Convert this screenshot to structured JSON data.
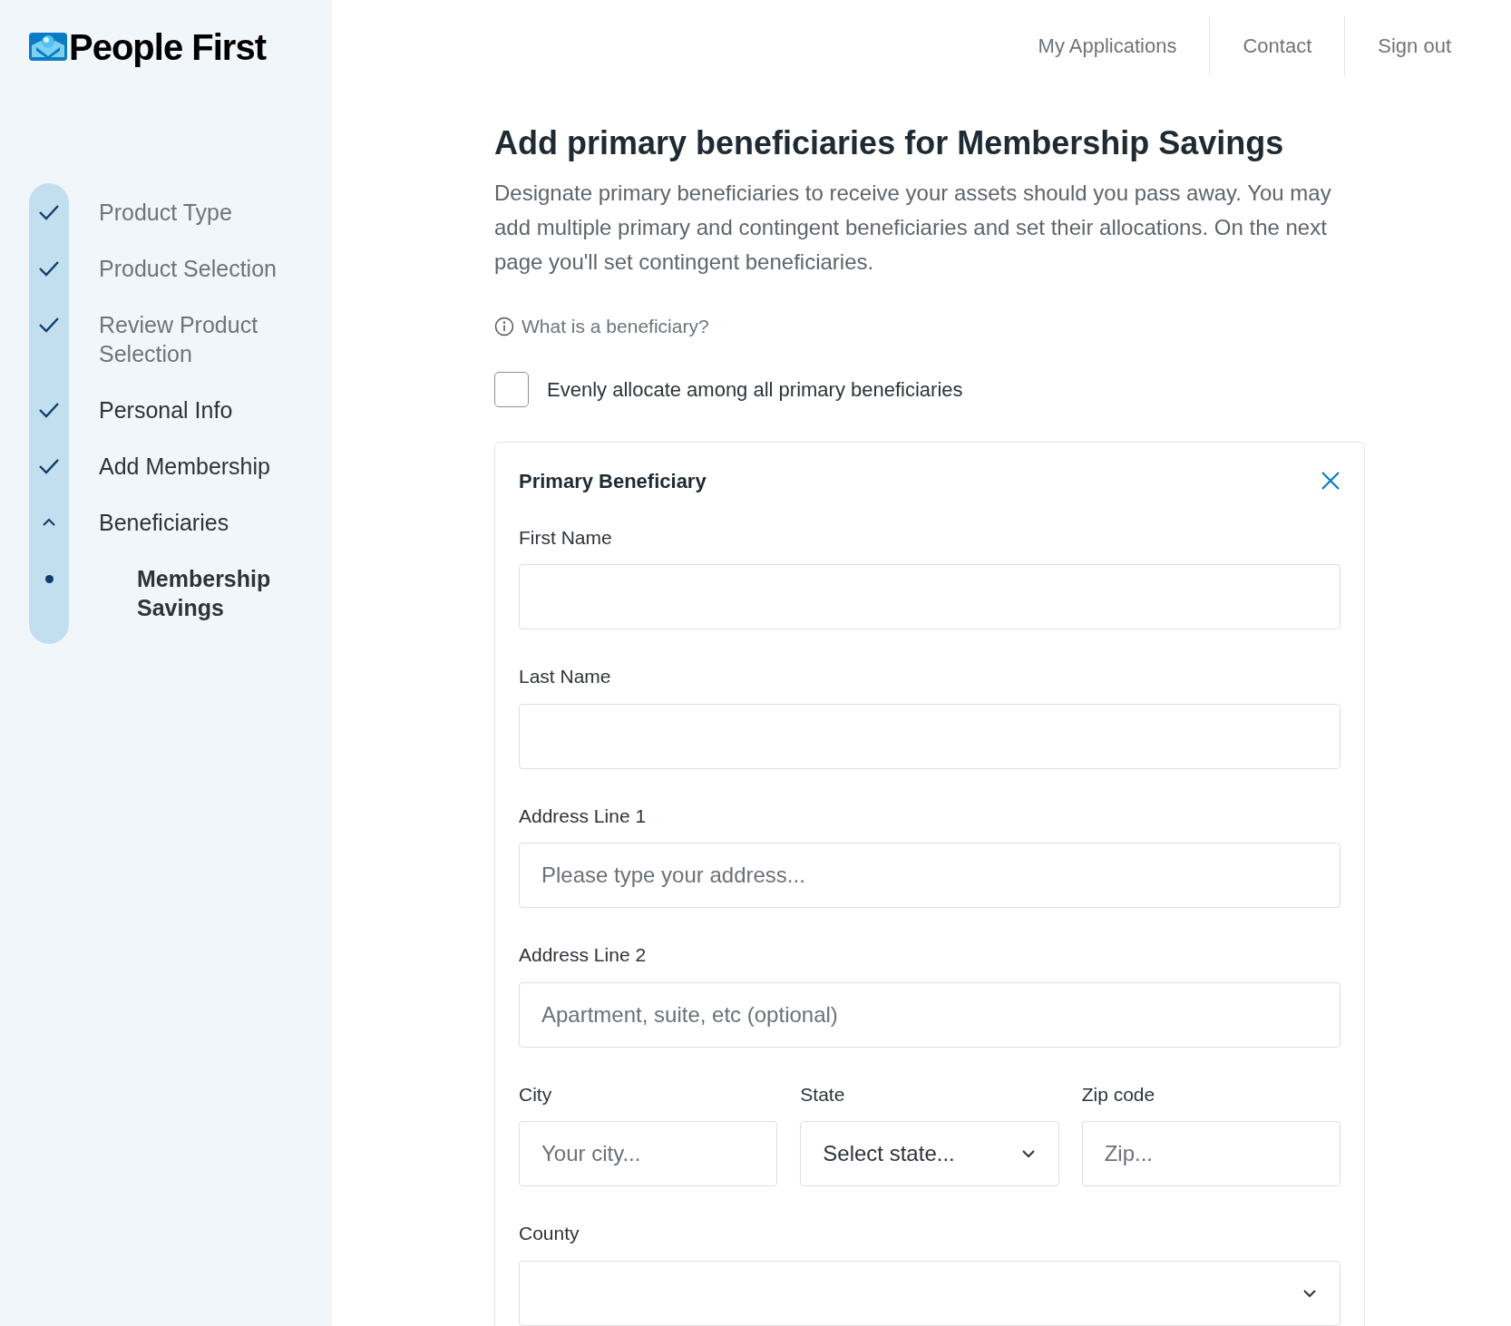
{
  "brand": {
    "name": "People First"
  },
  "nav": [
    "My Applications",
    "Contact",
    "Sign out"
  ],
  "steps": [
    {
      "label": "Product Type",
      "kind": "done",
      "dimmed": true,
      "selected": false
    },
    {
      "label": "Product Selection",
      "kind": "done",
      "dimmed": true,
      "selected": false
    },
    {
      "label": "Review Product Selection",
      "kind": "done",
      "dimmed": true,
      "selected": false
    },
    {
      "label": "Personal Info",
      "kind": "done",
      "dimmed": false,
      "selected": false
    },
    {
      "label": "Add Membership",
      "kind": "done",
      "dimmed": false,
      "selected": false
    },
    {
      "label": "Beneficiaries",
      "kind": "open",
      "dimmed": false,
      "selected": false
    },
    {
      "label": "Membership Savings",
      "kind": "sub",
      "dimmed": false,
      "selected": true
    }
  ],
  "page": {
    "title": "Add primary beneficiaries for Membership Savings",
    "description": "Designate primary beneficiaries to receive your assets should you pass away. You may add multiple primary and contingent beneficiaries and set their allocations. On the next page you'll set contingent beneficiaries.",
    "help_link": "What is a beneficiary?",
    "even_allocation": {
      "label": "Evenly allocate among all primary beneficiaries",
      "checked": false
    }
  },
  "card": {
    "title": "Primary Beneficiary",
    "rows": [
      {
        "fields": [
          {
            "label": "First Name",
            "kind": "text"
          }
        ]
      },
      {
        "fields": [
          {
            "label": "Last Name",
            "kind": "text"
          }
        ]
      },
      {
        "fields": [
          {
            "label": "Address Line 1",
            "kind": "text",
            "placeholder": "Please type your address..."
          }
        ]
      },
      {
        "fields": [
          {
            "label": "Address Line 2",
            "kind": "text",
            "placeholder": "Apartment, suite, etc (optional)"
          }
        ]
      },
      {
        "fields": [
          {
            "label": "City",
            "kind": "text",
            "placeholder": "Your city..."
          },
          {
            "label": "State",
            "kind": "select",
            "value": "Select state..."
          },
          {
            "label": "Zip code",
            "kind": "text",
            "placeholder": "Zip..."
          }
        ]
      },
      {
        "fields": [
          {
            "label": "County",
            "kind": "select"
          }
        ]
      }
    ]
  }
}
